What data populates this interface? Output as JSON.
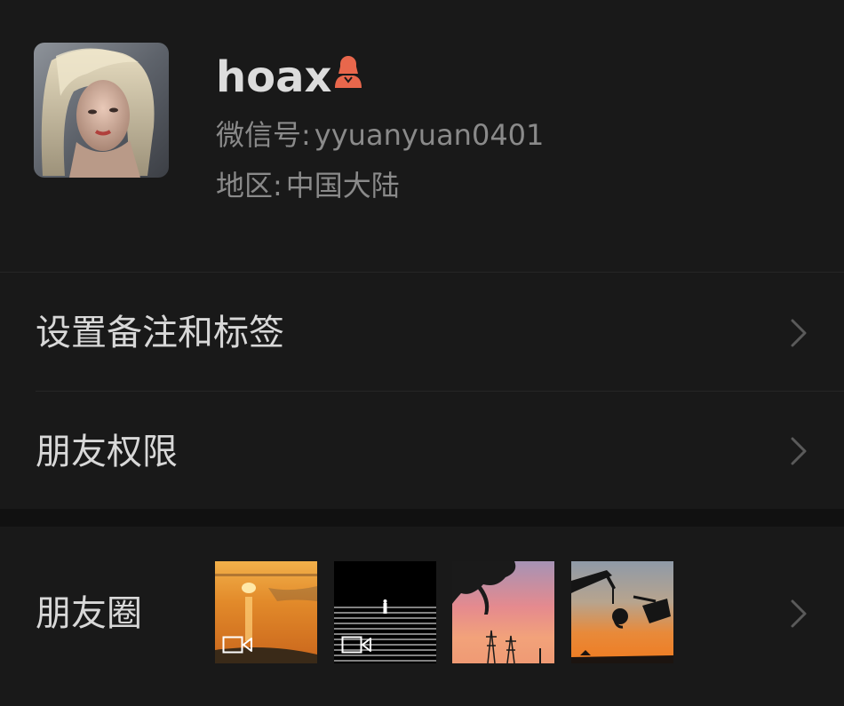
{
  "profile": {
    "nickname": "hoax",
    "wechat_id_label": "微信号:",
    "wechat_id": "yyuanyuan0401",
    "region_label": "地区:",
    "region": "中国大陆",
    "gender_icon": "female-icon",
    "gender_color": "#e8674c"
  },
  "menu": {
    "remark_tags": "设置备注和标签",
    "friend_permissions": "朋友权限",
    "moments": "朋友圈"
  },
  "moments_thumbnails": [
    {
      "type": "video",
      "icon": "video-icon"
    },
    {
      "type": "video",
      "icon": "video-icon"
    },
    {
      "type": "image"
    },
    {
      "type": "image"
    }
  ],
  "colors": {
    "background": "#191919",
    "section_gap": "#111111",
    "text_primary": "#d8d8d8",
    "text_secondary": "#8a8a8a"
  }
}
